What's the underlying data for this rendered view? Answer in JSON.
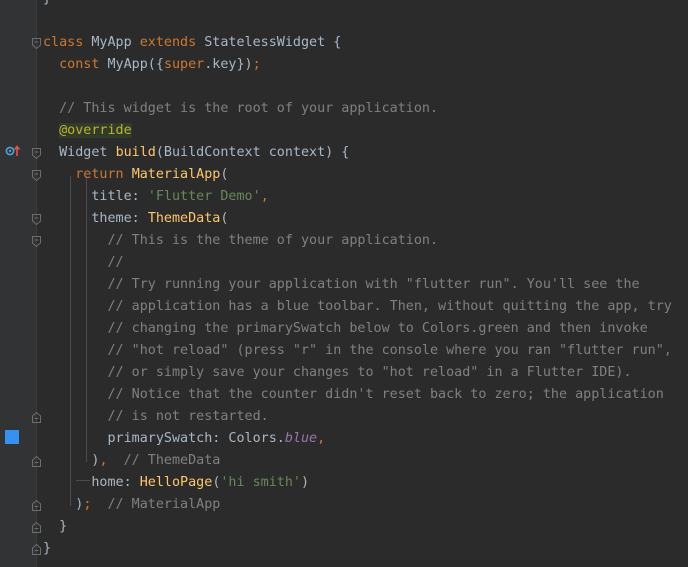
{
  "editor": {
    "lines": [
      {
        "id": "l00",
        "segments": [
          {
            "c": "dim",
            "t": "}"
          }
        ]
      },
      {
        "id": "l01",
        "segments": []
      },
      {
        "id": "l02",
        "segments": [
          {
            "c": "kw",
            "t": "class "
          },
          {
            "c": "cls",
            "t": "MyApp "
          },
          {
            "c": "kw",
            "t": "extends "
          },
          {
            "c": "cls",
            "t": "StatelessWidget {"
          }
        ]
      },
      {
        "id": "l03",
        "segments": [
          {
            "c": "kw",
            "t": "  const "
          },
          {
            "c": "cls",
            "t": "MyApp({"
          },
          {
            "c": "kw",
            "t": "super"
          },
          {
            "c": "cls",
            "t": ".key})"
          },
          {
            "c": "kw",
            "t": ";"
          }
        ]
      },
      {
        "id": "l04",
        "segments": []
      },
      {
        "id": "l05",
        "segments": [
          {
            "c": "cmt",
            "t": "  // This widget is the root of your application."
          }
        ]
      },
      {
        "id": "l06",
        "segments": [
          {
            "c": "dim",
            "t": "  "
          },
          {
            "c": "ann",
            "t": "@override"
          }
        ]
      },
      {
        "id": "l07",
        "segments": [
          {
            "c": "cls",
            "t": "  Widget "
          },
          {
            "c": "fn",
            "t": "build"
          },
          {
            "c": "cls",
            "t": "(BuildContext context) {"
          }
        ]
      },
      {
        "id": "l08",
        "segments": [
          {
            "c": "kw",
            "t": "    return "
          },
          {
            "c": "fn",
            "t": "MaterialApp"
          },
          {
            "c": "cls",
            "t": "("
          }
        ]
      },
      {
        "id": "l09",
        "segments": [
          {
            "c": "cls",
            "t": "      title: "
          },
          {
            "c": "str",
            "t": "'Flutter Demo'"
          },
          {
            "c": "kw",
            "t": ","
          }
        ]
      },
      {
        "id": "l10",
        "segments": [
          {
            "c": "cls",
            "t": "      theme: "
          },
          {
            "c": "fn",
            "t": "ThemeData"
          },
          {
            "c": "cls",
            "t": "("
          }
        ]
      },
      {
        "id": "l11",
        "segments": [
          {
            "c": "cmt",
            "t": "        // This is the theme of your application."
          }
        ]
      },
      {
        "id": "l12",
        "segments": [
          {
            "c": "cmt",
            "t": "        //"
          }
        ]
      },
      {
        "id": "l13",
        "segments": [
          {
            "c": "cmt",
            "t": "        // Try running your application with \"flutter run\". You'll see the"
          }
        ]
      },
      {
        "id": "l14",
        "segments": [
          {
            "c": "cmt",
            "t": "        // application has a blue toolbar. Then, without quitting the app, try"
          }
        ]
      },
      {
        "id": "l15",
        "segments": [
          {
            "c": "cmt",
            "t": "        // changing the primarySwatch below to Colors.green and then invoke"
          }
        ]
      },
      {
        "id": "l16",
        "segments": [
          {
            "c": "cmt",
            "t": "        // \"hot reload\" (press \"r\" in the console where you ran \"flutter run\","
          }
        ]
      },
      {
        "id": "l17",
        "segments": [
          {
            "c": "cmt",
            "t": "        // or simply save your changes to \"hot reload\" in a Flutter IDE)."
          }
        ]
      },
      {
        "id": "l18",
        "segments": [
          {
            "c": "cmt",
            "t": "        // Notice that the counter didn't reset back to zero; the application"
          }
        ]
      },
      {
        "id": "l19",
        "segments": [
          {
            "c": "cmt",
            "t": "        // is not restarted."
          }
        ]
      },
      {
        "id": "l20",
        "segments": [
          {
            "c": "cls",
            "t": "        primarySwatch: Colors."
          },
          {
            "c": "ital",
            "t": "blue"
          },
          {
            "c": "kw",
            "t": ","
          }
        ]
      },
      {
        "id": "l21",
        "segments": [
          {
            "c": "cls",
            "t": "      )"
          },
          {
            "c": "kw",
            "t": ","
          },
          {
            "c": "cmt",
            "t": "  // ThemeData"
          }
        ]
      },
      {
        "id": "l22",
        "segments": [
          {
            "c": "cls",
            "t": "      home: "
          },
          {
            "c": "fn",
            "t": "HelloPage"
          },
          {
            "c": "cls",
            "t": "("
          },
          {
            "c": "str",
            "t": "'hi smith'"
          },
          {
            "c": "cls",
            "t": ")"
          }
        ]
      },
      {
        "id": "l23",
        "segments": [
          {
            "c": "cls",
            "t": "    )"
          },
          {
            "c": "kw",
            "t": ";"
          },
          {
            "c": "cmt",
            "t": "  // MaterialApp"
          }
        ]
      },
      {
        "id": "l24",
        "segments": [
          {
            "c": "cls",
            "t": "  }"
          }
        ]
      },
      {
        "id": "l25",
        "segments": [
          {
            "c": "cls",
            "t": "}"
          }
        ]
      }
    ]
  },
  "gutter": {
    "override_icon": "override-method-icon",
    "bookmark_color": "#3592f0"
  },
  "colors": {
    "background": "#2b2b2b",
    "keyword": "#cc7832",
    "function": "#ffc66d",
    "string": "#6a8759",
    "comment": "#808080",
    "annotation": "#bbb529",
    "field": "#9876aa"
  }
}
